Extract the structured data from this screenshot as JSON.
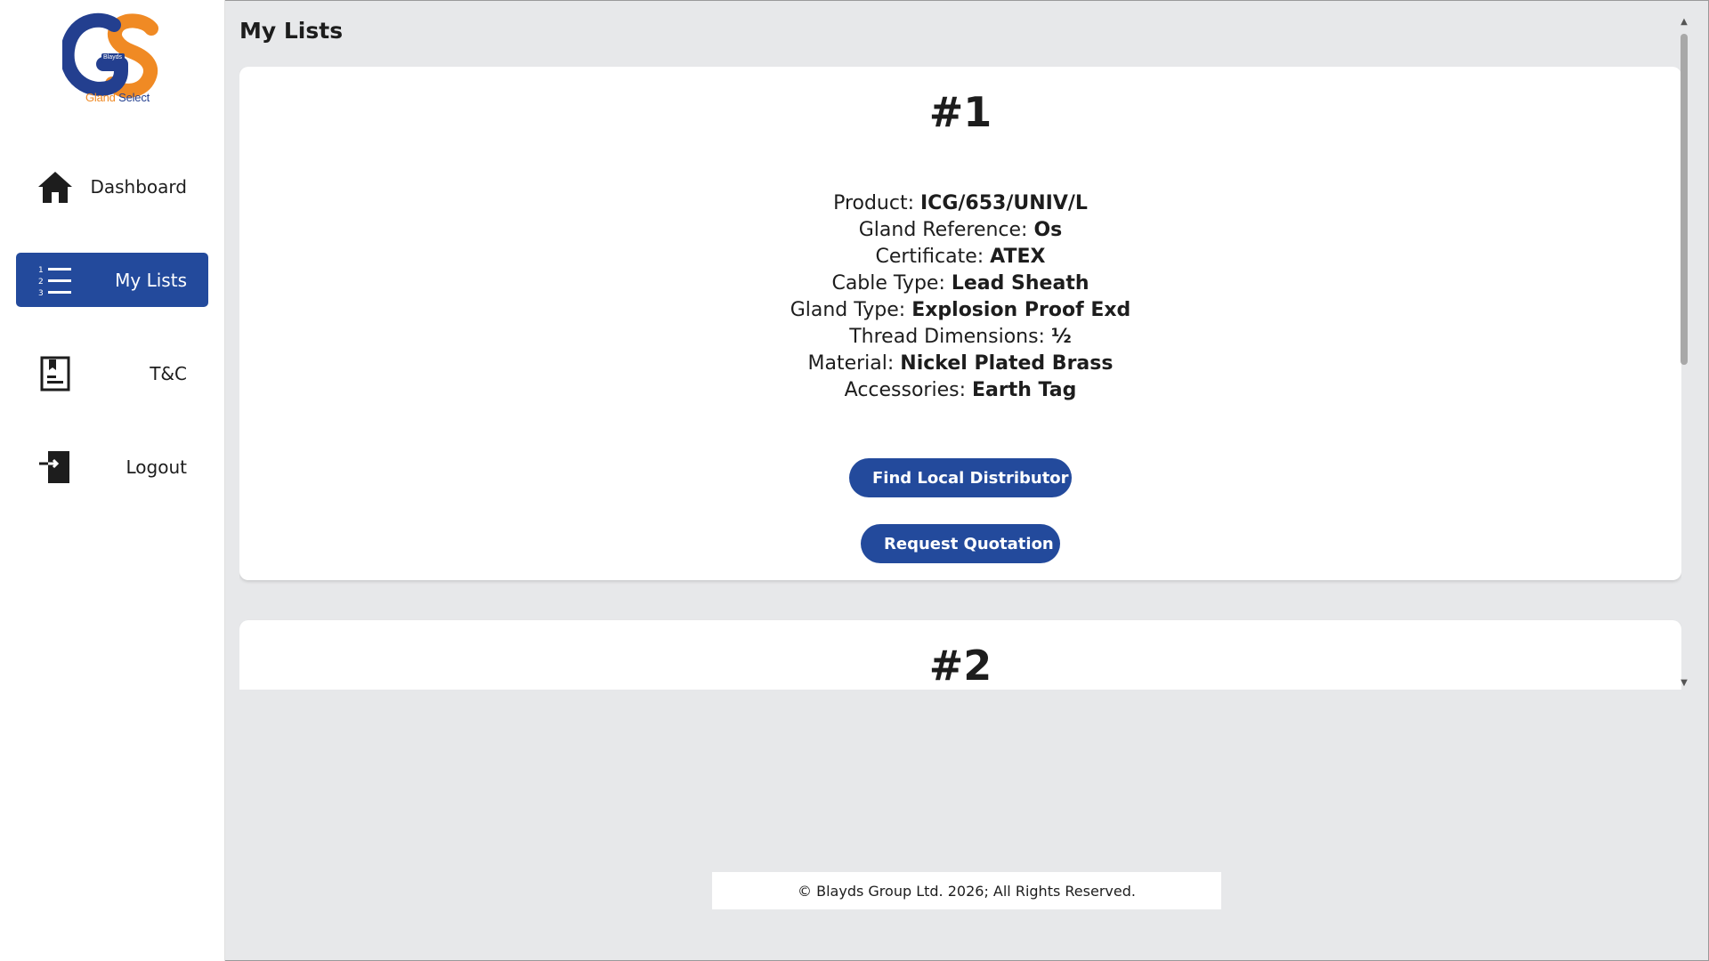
{
  "brand": {
    "logo_small": "Blayds",
    "logo_word1": "Gland",
    "logo_word2": "Select"
  },
  "sidebar": {
    "items": [
      {
        "label": "Dashboard",
        "icon": "home-icon"
      },
      {
        "label": "My Lists",
        "icon": "numbered-list-icon",
        "active": true
      },
      {
        "label": "T&C",
        "icon": "document-icon"
      },
      {
        "label": "Logout",
        "icon": "logout-icon"
      }
    ]
  },
  "page": {
    "title": "My Lists"
  },
  "lists": [
    {
      "number": "#1",
      "details": [
        {
          "label": "Product: ",
          "value": "ICG/653/UNIV/L"
        },
        {
          "label": "Gland Reference: ",
          "value": "Os"
        },
        {
          "label": "Certificate: ",
          "value": "ATEX"
        },
        {
          "label": "Cable Type: ",
          "value": "Lead Sheath"
        },
        {
          "label": "Gland Type: ",
          "value": "Explosion Proof Exd"
        },
        {
          "label": "Thread Dimensions: ",
          "value": "½"
        },
        {
          "label": "Material: ",
          "value": "Nickel Plated Brass"
        },
        {
          "label": "Accessories: ",
          "value": "Earth Tag"
        }
      ],
      "buttons": {
        "distributor": "Find Local Distributor",
        "quotation": "Request Quotation"
      }
    },
    {
      "number": "#2"
    }
  ],
  "footer": {
    "text": "© Blayds Group Ltd. 2026; All Rights Reserved."
  },
  "colors": {
    "primary": "#234a9c",
    "accent": "#f08a24",
    "background": "#e7e8ea"
  }
}
